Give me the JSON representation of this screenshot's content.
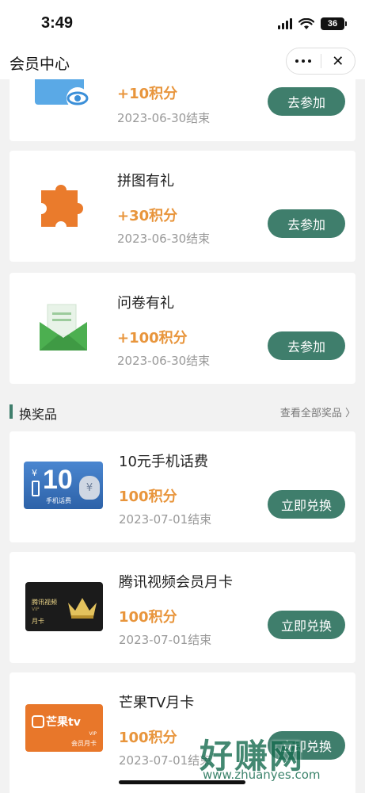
{
  "status_bar": {
    "time": "3:49",
    "battery": "36"
  },
  "nav": {
    "title": "会员中心",
    "close_glyph": "✕"
  },
  "tasks": [
    {
      "title": "",
      "points": "+10积分",
      "date": "2023-06-30结束",
      "button": "去参加",
      "icon": "eye-card-icon"
    },
    {
      "title": "拼图有礼",
      "points": "+30积分",
      "date": "2023-06-30结束",
      "button": "去参加",
      "icon": "puzzle-icon"
    },
    {
      "title": "问卷有礼",
      "points": "+100积分",
      "date": "2023-06-30结束",
      "button": "去参加",
      "icon": "envelope-icon"
    }
  ],
  "rewards_section": {
    "title": "换奖品",
    "view_all": "查看全部奖品 〉"
  },
  "rewards": [
    {
      "title": "10元手机话费",
      "points": "100积分",
      "date": "2023-07-01结束",
      "button": "立即兑换",
      "image": {
        "amount": "10",
        "yen": "¥",
        "caption": "手机话费"
      }
    },
    {
      "title": "腾讯视频会员月卡",
      "points": "100积分",
      "date": "2023-07-01结束",
      "button": "立即兑换",
      "image": {
        "brand": "腾讯视频",
        "caption": "月卡",
        "vip": "VIP"
      }
    },
    {
      "title": "芒果TV月卡",
      "points": "100积分",
      "date": "2023-07-01结束",
      "button": "立即兑换",
      "image": {
        "brand": "芒果tv",
        "vip": "VIP",
        "caption": "会员月卡"
      }
    }
  ],
  "watermark": {
    "big": "好赚网",
    "small": "www.zhuanyes.com"
  },
  "colors": {
    "accent": "#3f7e6c",
    "points": "#e8953c",
    "date": "#999999"
  }
}
